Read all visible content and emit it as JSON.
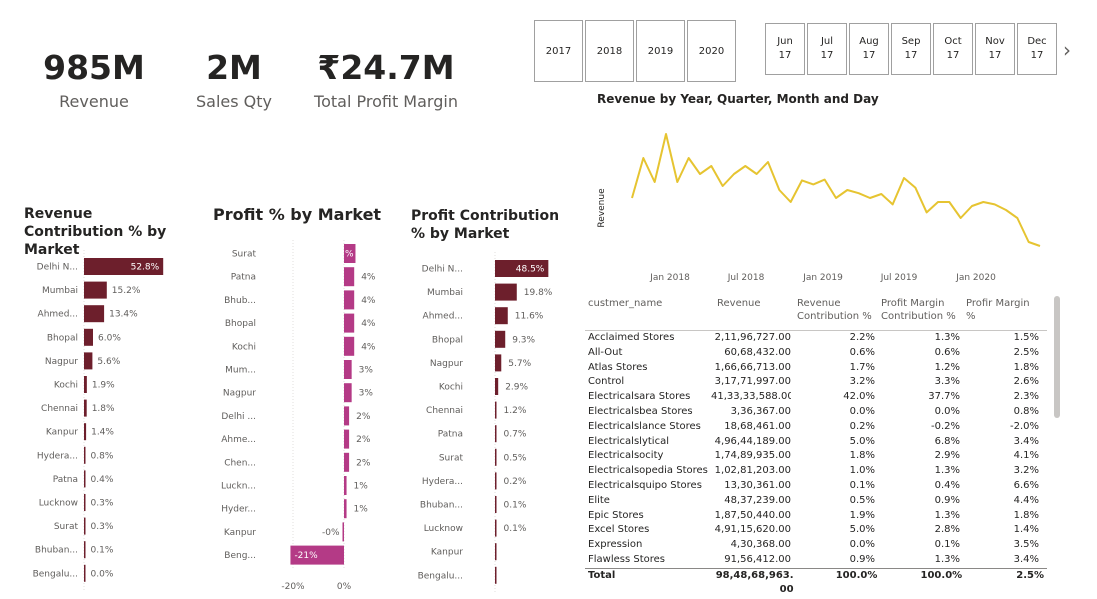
{
  "kpis": [
    {
      "value": "985M",
      "label": "Revenue"
    },
    {
      "value": "2M",
      "label": "Sales Qty"
    },
    {
      "value": "₹24.7M",
      "label": "Total Profit Margin"
    }
  ],
  "year_slicer": [
    "2017",
    "2018",
    "2019",
    "2020"
  ],
  "month_slicer": [
    {
      "m": "Jun",
      "y": "17"
    },
    {
      "m": "Jul",
      "y": "17"
    },
    {
      "m": "Aug",
      "y": "17"
    },
    {
      "m": "Sep",
      "y": "17"
    },
    {
      "m": "Oct",
      "y": "17"
    },
    {
      "m": "Nov",
      "y": "17"
    },
    {
      "m": "Dec",
      "y": "17"
    }
  ],
  "month_next_glyph": "›",
  "colors": {
    "revenue_bar": "#6d1f2c",
    "profit_bar": "#b43a86",
    "line": "#e6c431"
  },
  "chart_data": [
    {
      "type": "bar",
      "orientation": "horizontal",
      "title": "Revenue Contribution % by Market",
      "categories": [
        "Delhi N...",
        "Mumbai",
        "Ahmed...",
        "Bhopal",
        "Nagpur",
        "Kochi",
        "Chennai",
        "Kanpur",
        "Hydera...",
        "Patna",
        "Lucknow",
        "Surat",
        "Bhuban...",
        "Bengalu..."
      ],
      "values": [
        52.8,
        15.2,
        13.4,
        6.0,
        5.6,
        1.9,
        1.8,
        1.4,
        0.8,
        0.4,
        0.3,
        0.3,
        0.1,
        0.0
      ],
      "labels": [
        "52.8%",
        "15.2%",
        "13.4%",
        "6.0%",
        "5.6%",
        "1.9%",
        "1.8%",
        "1.4%",
        "0.8%",
        "0.4%",
        "0.3%",
        "0.3%",
        "0.1%",
        "0.0%"
      ]
    },
    {
      "type": "bar",
      "orientation": "horizontal",
      "title": "Profit % by Market",
      "categories": [
        "Surat",
        "Patna",
        "Bhub...",
        "Bhopal",
        "Kochi",
        "Mum...",
        "Nagpur",
        "Delhi ...",
        "Ahme...",
        "Chen...",
        "Luckn...",
        "Hyder...",
        "Kanpur",
        "Beng..."
      ],
      "values": [
        4.5,
        4.0,
        4.0,
        4.0,
        4.0,
        3.0,
        3.0,
        2.0,
        2.0,
        2.0,
        1.0,
        1.0,
        -0.2,
        -21.0
      ],
      "labels": [
        "%",
        "4%",
        "4%",
        "4%",
        "4%",
        "3%",
        "3%",
        "2%",
        "2%",
        "2%",
        "1%",
        "1%",
        "-0%",
        "-21%"
      ],
      "xticks": [
        "-20%",
        "0%"
      ],
      "xlim": [
        -20,
        0
      ]
    },
    {
      "type": "bar",
      "orientation": "horizontal",
      "title": "Profit Contribution % by Market",
      "categories": [
        "Delhi N...",
        "Mumbai",
        "Ahmed...",
        "Bhopal",
        "Nagpur",
        "Kochi",
        "Chennai",
        "Patna",
        "Surat",
        "Hydera...",
        "Bhuban...",
        "Lucknow",
        "Kanpur",
        "Bengalu..."
      ],
      "values": [
        48.5,
        19.8,
        11.6,
        9.3,
        5.7,
        2.9,
        1.2,
        0.7,
        0.5,
        0.2,
        0.1,
        0.1,
        0.0,
        0.0
      ],
      "labels": [
        "48.5%",
        "19.8%",
        "11.6%",
        "9.3%",
        "5.7%",
        "2.9%",
        "1.2%",
        "0.7%",
        "0.5%",
        "0.2%",
        "0.1%",
        "0.1%",
        "",
        ""
      ]
    },
    {
      "type": "line",
      "title": "Revenue by Year, Quarter, Month and Day",
      "ylabel": "Revenue",
      "xticks": [
        "Jan 2018",
        "Jul 2018",
        "Jan 2019",
        "Jul 2019",
        "Jan 2020"
      ],
      "x": [
        "Jun 2017",
        "Jul 2017",
        "Aug 2017",
        "Sep 2017",
        "Oct 2017",
        "Nov 2017",
        "Dec 2017",
        "Jan 2018",
        "Feb 2018",
        "Mar 2018",
        "Apr 2018",
        "May 2018",
        "Jun 2018",
        "Jul 2018",
        "Aug 2018",
        "Sep 2018",
        "Oct 2018",
        "Nov 2018",
        "Dec 2018",
        "Jan 2019",
        "Feb 2019",
        "Mar 2019",
        "Apr 2019",
        "May 2019",
        "Jun 2019",
        "Jul 2019",
        "Aug 2019",
        "Sep 2019",
        "Oct 2019",
        "Nov 2019",
        "Dec 2019",
        "Jan 2020",
        "Feb 2020",
        "Mar 2020",
        "Apr 2020",
        "May 2020",
        "Jun 2020"
      ],
      "y": [
        0.6,
        1.1,
        0.8,
        1.4,
        0.8,
        1.1,
        0.9,
        1.0,
        0.75,
        0.9,
        1.0,
        0.9,
        1.05,
        0.7,
        0.55,
        0.82,
        0.77,
        0.83,
        0.6,
        0.7,
        0.66,
        0.6,
        0.65,
        0.52,
        0.85,
        0.73,
        0.42,
        0.55,
        0.55,
        0.35,
        0.5,
        0.55,
        0.52,
        0.45,
        0.35,
        0.05,
        0.0
      ],
      "ylim": [
        0,
        1.5
      ],
      "grid": false
    },
    {
      "type": "table",
      "columns": [
        "custmer_name",
        "Revenue",
        "Revenue Contribution %",
        "Profit Margin Contribution %",
        "Profir Margin %"
      ],
      "rows": [
        [
          "Acclaimed Stores",
          "2,11,96,727.00",
          "2.2%",
          "1.3%",
          "1.5%"
        ],
        [
          "All-Out",
          "60,68,432.00",
          "0.6%",
          "0.6%",
          "2.5%"
        ],
        [
          "Atlas Stores",
          "1,66,66,713.00",
          "1.7%",
          "1.2%",
          "1.8%"
        ],
        [
          "Control",
          "3,17,71,997.00",
          "3.2%",
          "3.3%",
          "2.6%"
        ],
        [
          "Electricalsara Stores",
          "41,33,33,588.00",
          "42.0%",
          "37.7%",
          "2.3%"
        ],
        [
          "Electricalsbea Stores",
          "3,36,367.00",
          "0.0%",
          "0.0%",
          "0.8%"
        ],
        [
          "Electricalslance Stores",
          "18,68,461.00",
          "0.2%",
          "-0.2%",
          "-2.0%"
        ],
        [
          "Electricalslytical",
          "4,96,44,189.00",
          "5.0%",
          "6.8%",
          "3.4%"
        ],
        [
          "Electricalsocity",
          "1,74,89,935.00",
          "1.8%",
          "2.9%",
          "4.1%"
        ],
        [
          "Electricalsopedia Stores",
          "1,02,81,203.00",
          "1.0%",
          "1.3%",
          "3.2%"
        ],
        [
          "Electricalsquipo Stores",
          "13,30,361.00",
          "0.1%",
          "0.4%",
          "6.6%"
        ],
        [
          "Elite",
          "48,37,239.00",
          "0.5%",
          "0.9%",
          "4.4%"
        ],
        [
          "Epic Stores",
          "1,87,50,440.00",
          "1.9%",
          "1.3%",
          "1.8%"
        ],
        [
          "Excel Stores",
          "4,91,15,620.00",
          "5.0%",
          "2.8%",
          "1.4%"
        ],
        [
          "Expression",
          "4,30,368.00",
          "0.0%",
          "0.1%",
          "3.5%"
        ],
        [
          "Flawless Stores",
          "91,56,412.00",
          "0.9%",
          "1.3%",
          "3.4%"
        ]
      ],
      "total": [
        "Total",
        "98,48,68,963.00",
        "100.0%",
        "100.0%",
        "2.5%"
      ]
    }
  ]
}
